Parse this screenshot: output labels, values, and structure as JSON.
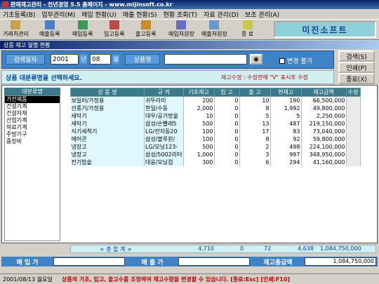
{
  "window_title": "판매재고관리 - 천년경영 5.5  홈페이지 - www.mijinsoft.co.kr",
  "menu": [
    "기초등록(B)",
    "업무관리(M)",
    "매입 현황(U)",
    "매출 현황(S)",
    "현황 조회(T)",
    "자료 관리(D)",
    "보조 관리(A)"
  ],
  "toolbar": [
    {
      "label": "거래처관리",
      "icon": "customer-icon"
    },
    {
      "label": "매출등록",
      "icon": "sales-icon"
    },
    {
      "label": "매입등록",
      "icon": "purchase-icon"
    },
    {
      "label": "입고등록",
      "icon": "inbound-icon"
    },
    {
      "label": "출고등록",
      "icon": "outbound-icon"
    },
    {
      "label": "매입처원장",
      "icon": "ledger-icon"
    },
    {
      "label": "매출처원장",
      "icon": "ledger-icon"
    },
    {
      "label": "종 료",
      "icon": "exit-icon"
    }
  ],
  "brand": "미진소프트",
  "form_title": "상품 재고 월별 현황",
  "search": {
    "date_label": "검색일자",
    "year": "2001",
    "year_unit": "년",
    "month": "08",
    "month_unit": "월",
    "product_label": "상품명",
    "product_value": "",
    "lock_label": "변경 불가"
  },
  "buttons": {
    "search": "검색(S)",
    "print": "인쇄(P)",
    "close": "종료(X)"
  },
  "hint": "상품 대분류명을 선택하세요.",
  "hint_edit": "재고수정 : 수정란에 \"V\" 표시후 수정",
  "categories_header": "대분류명",
  "categories": [
    "가전제품",
    "건설기계",
    "건설자재",
    "산업기계",
    "의료기계",
    "주방기구",
    "중장비"
  ],
  "table": {
    "columns": [
      "상 품 명",
      "규 격",
      "기초재고",
      "입 고",
      "출 고",
      "현재고",
      "재고금액",
      "수정"
    ],
    "rows": [
      [
        "보일러/가정용",
        "귀뚜라미",
        "200",
        "0",
        "10",
        "190",
        "66,500,000",
        ""
      ],
      [
        "선풍기/가정용",
        "한일/수동",
        "2,000",
        "0",
        "8",
        "1,992",
        "49,800,000",
        ""
      ],
      [
        "세탁기",
        "대우/공기방울",
        "10",
        "0",
        "5",
        "5",
        "2,250,000",
        ""
      ],
      [
        "세탁기",
        "삼성/손빨래5",
        "500",
        "0",
        "13",
        "487",
        "219,150,000",
        ""
      ],
      [
        "식기세척기",
        "LG/전자동20",
        "100",
        "0",
        "17",
        "83",
        "73,040,000",
        ""
      ],
      [
        "에어콘",
        "삼성/블루윈/",
        "100",
        "0",
        "8",
        "92",
        "59,800,000",
        ""
      ],
      [
        "냉장고",
        "LG/모닝123-",
        "500",
        "0",
        "2",
        "498",
        "224,100,000",
        ""
      ],
      [
        "냉장고",
        "삼성/5002리터",
        "1,000",
        "0",
        "3",
        "997",
        "348,950,000",
        ""
      ],
      [
        "전기밥솥",
        "대웅/모닝컴",
        "300",
        "0",
        "6",
        "294",
        "41,160,000",
        ""
      ]
    ]
  },
  "totals": {
    "label": "< 총   합   계 >",
    "base": "4,710",
    "in": "0",
    "out": "72",
    "current": "4,638",
    "amount": "1,084,750,000"
  },
  "bottom": {
    "purchase_label": "매 입 가",
    "sales_label": "매 출 가",
    "stock_amount_label": "재고총금액",
    "stock_amount": "1,084,750,000"
  },
  "status": {
    "date": "2001/08/13 월요일",
    "message": "상품의 기초, 입고, 출고수를 조정하여 재고수량을 변경할 수 있습니다.  [종료:Esc]  [인쇄:F10]"
  }
}
